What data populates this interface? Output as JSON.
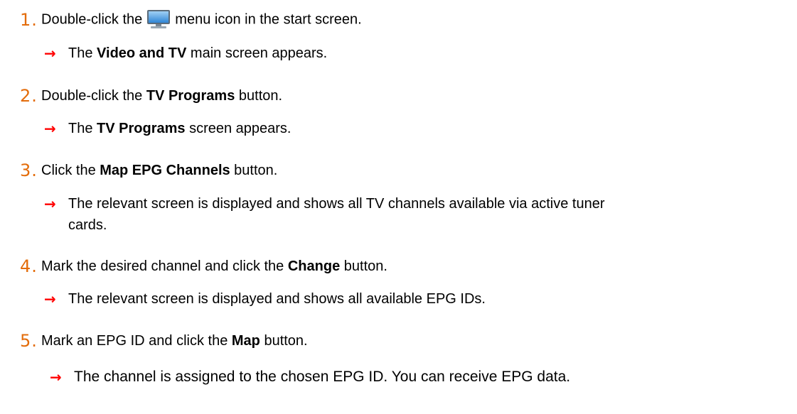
{
  "steps": [
    {
      "number": "1.",
      "parts": [
        "Double-click the",
        "menu icon in the start screen."
      ],
      "icon": "monitor-icon",
      "result": {
        "pre": "The ",
        "bold": "Video and TV",
        "post": " main screen appears."
      }
    },
    {
      "number": "2.",
      "parts": {
        "pre": "Double-click the ",
        "bold": "TV Programs",
        "post": " button."
      },
      "result": {
        "pre": "The ",
        "bold": "TV Programs",
        "post": " screen appears."
      }
    },
    {
      "number": "3.",
      "parts": {
        "pre": "Click the ",
        "bold": "Map EPG Channels",
        "post": " button."
      },
      "result": {
        "line1": "The relevant screen is displayed and shows all TV channels available via active tuner",
        "line2": "cards."
      }
    },
    {
      "number": "4.",
      "parts": {
        "pre": "Mark the desired channel and click the ",
        "bold": "Change",
        "post": " button."
      },
      "result": {
        "text": "The relevant screen is displayed and shows all available EPG IDs."
      }
    },
    {
      "number": "5.",
      "parts": {
        "pre": "Mark an EPG ID and click the ",
        "bold": "Map",
        "post": " button."
      },
      "result": {
        "text": "The channel is assigned to the chosen EPG ID. You can receive EPG data."
      }
    }
  ],
  "arrow_glyph": "→",
  "colors": {
    "step_number": "#e36c0a",
    "arrow": "#ff0000"
  }
}
